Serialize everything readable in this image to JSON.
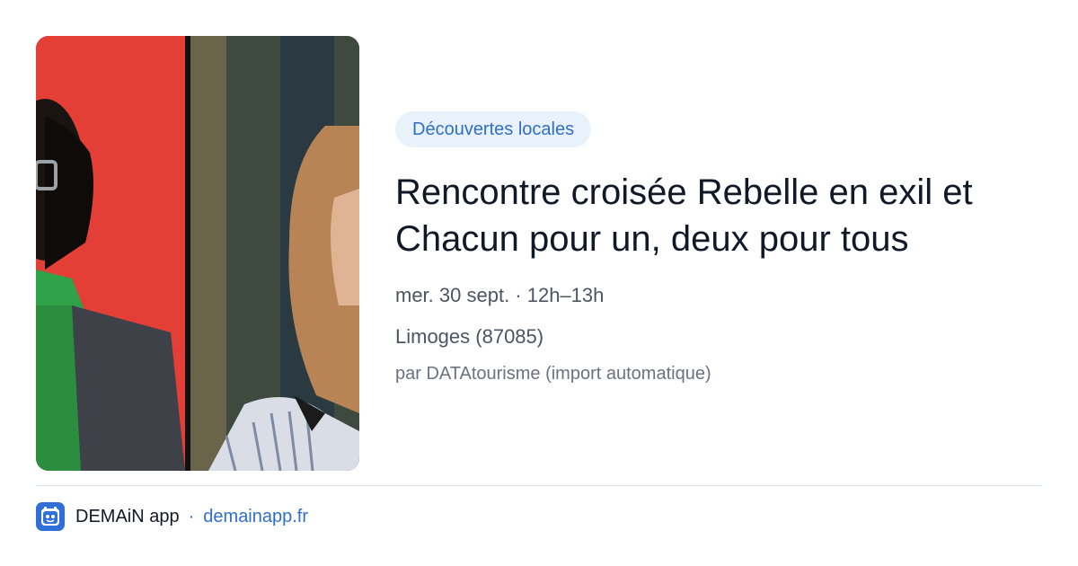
{
  "event": {
    "image_alt": "Photo de deux personnes",
    "category": "Découvertes locales",
    "title": "Rencontre croisée Rebelle en exil et Chacun pour un, deux pour tous",
    "date": "mer. 30 sept. · 12h–13h",
    "location": "Limoges (87085)",
    "source": "par DATAtourisme (import automatique)"
  },
  "footer": {
    "app_name": "DEMAiN app",
    "separator": "·",
    "url": "demainapp.fr",
    "icon": "demain-app-logo-icon"
  },
  "colors": {
    "accent": "#2f6fc9",
    "category_bg": "#e9f1fb"
  }
}
